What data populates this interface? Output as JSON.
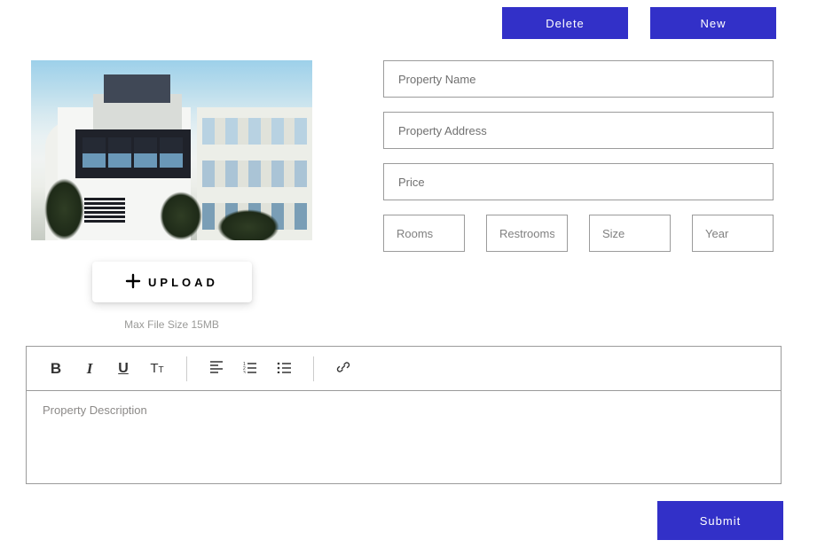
{
  "topButtons": {
    "delete": "Delete",
    "new": "New"
  },
  "upload": {
    "label": "UPLOAD",
    "fileHint": "Max File Size 15MB"
  },
  "form": {
    "propertyName": {
      "placeholder": "Property Name",
      "value": ""
    },
    "propertyAddress": {
      "placeholder": "Property Address",
      "value": ""
    },
    "price": {
      "placeholder": "Price",
      "value": ""
    },
    "rooms": {
      "placeholder": "Rooms",
      "value": ""
    },
    "restrooms": {
      "placeholder": "Restrooms",
      "value": ""
    },
    "size": {
      "placeholder": "Size",
      "value": ""
    },
    "year": {
      "placeholder": "Year",
      "value": ""
    }
  },
  "editor": {
    "placeholder": "Property Description"
  },
  "submit": "Submit"
}
